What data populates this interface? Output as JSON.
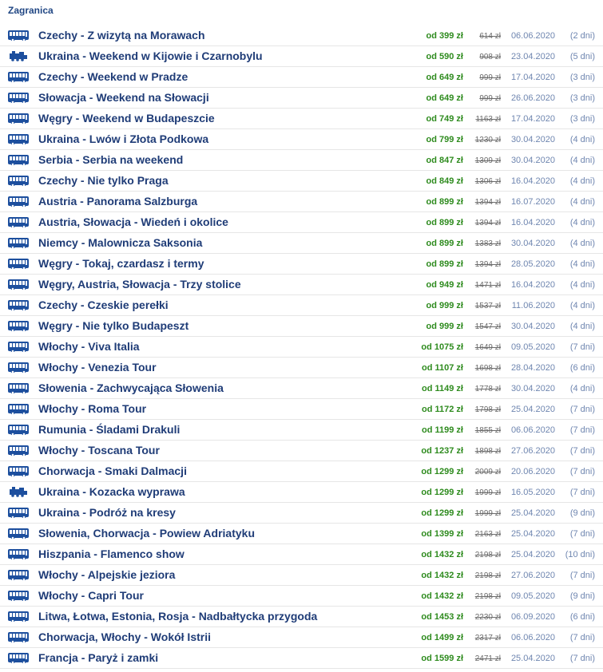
{
  "section_title": "Zagranica",
  "items": [
    {
      "transport": "bus",
      "title": "Czechy - Z wizytą na Morawach",
      "price": "od 399 zł",
      "old": "614 zł",
      "date": "06.06.2020",
      "duration": "(2 dni)"
    },
    {
      "transport": "train",
      "title": "Ukraina - Weekend w Kijowie i Czarnobylu",
      "price": "od 590 zł",
      "old": "908 zł",
      "date": "23.04.2020",
      "duration": "(5 dni)"
    },
    {
      "transport": "bus",
      "title": "Czechy - Weekend w Pradze",
      "price": "od 649 zł",
      "old": "999 zł",
      "date": "17.04.2020",
      "duration": "(3 dni)"
    },
    {
      "transport": "bus",
      "title": "Słowacja - Weekend na Słowacji",
      "price": "od 649 zł",
      "old": "999 zł",
      "date": "26.06.2020",
      "duration": "(3 dni)"
    },
    {
      "transport": "bus",
      "title": "Węgry - Weekend w Budapeszcie",
      "price": "od 749 zł",
      "old": "1163 zł",
      "date": "17.04.2020",
      "duration": "(3 dni)"
    },
    {
      "transport": "bus",
      "title": "Ukraina - Lwów i Złota Podkowa",
      "price": "od 799 zł",
      "old": "1230 zł",
      "date": "30.04.2020",
      "duration": "(4 dni)"
    },
    {
      "transport": "bus",
      "title": "Serbia - Serbia na weekend",
      "price": "od 847 zł",
      "old": "1309 zł",
      "date": "30.04.2020",
      "duration": "(4 dni)"
    },
    {
      "transport": "bus",
      "title": "Czechy - Nie tylko Praga",
      "price": "od 849 zł",
      "old": "1306 zł",
      "date": "16.04.2020",
      "duration": "(4 dni)"
    },
    {
      "transport": "bus",
      "title": "Austria - Panorama Salzburga",
      "price": "od 899 zł",
      "old": "1394 zł",
      "date": "16.07.2020",
      "duration": "(4 dni)"
    },
    {
      "transport": "bus",
      "title": "Austria, Słowacja - Wiedeń i okolice",
      "price": "od 899 zł",
      "old": "1394 zł",
      "date": "16.04.2020",
      "duration": "(4 dni)"
    },
    {
      "transport": "bus",
      "title": "Niemcy - Malownicza Saksonia",
      "price": "od 899 zł",
      "old": "1383 zł",
      "date": "30.04.2020",
      "duration": "(4 dni)"
    },
    {
      "transport": "bus",
      "title": "Węgry - Tokaj, czardasz i termy",
      "price": "od 899 zł",
      "old": "1394 zł",
      "date": "28.05.2020",
      "duration": "(4 dni)"
    },
    {
      "transport": "bus",
      "title": "Węgry, Austria, Słowacja - Trzy stolice",
      "price": "od 949 zł",
      "old": "1471 zł",
      "date": "16.04.2020",
      "duration": "(4 dni)"
    },
    {
      "transport": "bus",
      "title": "Czechy - Czeskie perełki",
      "price": "od 999 zł",
      "old": "1537 zł",
      "date": "11.06.2020",
      "duration": "(4 dni)"
    },
    {
      "transport": "bus",
      "title": "Węgry - Nie tylko Budapeszt",
      "price": "od 999 zł",
      "old": "1547 zł",
      "date": "30.04.2020",
      "duration": "(4 dni)"
    },
    {
      "transport": "bus",
      "title": "Włochy - Viva Italia",
      "price": "od 1075 zł",
      "old": "1649 zł",
      "date": "09.05.2020",
      "duration": "(7 dni)"
    },
    {
      "transport": "bus",
      "title": "Włochy - Venezia Tour",
      "price": "od 1107 zł",
      "old": "1698 zł",
      "date": "28.04.2020",
      "duration": "(6 dni)"
    },
    {
      "transport": "bus",
      "title": "Słowenia - Zachwycająca Słowenia",
      "price": "od 1149 zł",
      "old": "1778 zł",
      "date": "30.04.2020",
      "duration": "(4 dni)"
    },
    {
      "transport": "bus",
      "title": "Włochy - Roma Tour",
      "price": "od 1172 zł",
      "old": "1798 zł",
      "date": "25.04.2020",
      "duration": "(7 dni)"
    },
    {
      "transport": "bus",
      "title": "Rumunia - Śladami Drakuli",
      "price": "od 1199 zł",
      "old": "1855 zł",
      "date": "06.06.2020",
      "duration": "(7 dni)"
    },
    {
      "transport": "bus",
      "title": "Włochy - Toscana Tour",
      "price": "od 1237 zł",
      "old": "1898 zł",
      "date": "27.06.2020",
      "duration": "(7 dni)"
    },
    {
      "transport": "bus",
      "title": "Chorwacja - Smaki Dalmacji",
      "price": "od 1299 zł",
      "old": "2009 zł",
      "date": "20.06.2020",
      "duration": "(7 dni)"
    },
    {
      "transport": "train",
      "title": "Ukraina - Kozacka wyprawa",
      "price": "od 1299 zł",
      "old": "1999 zł",
      "date": "16.05.2020",
      "duration": "(7 dni)"
    },
    {
      "transport": "bus",
      "title": "Ukraina - Podróż na kresy",
      "price": "od 1299 zł",
      "old": "1999 zł",
      "date": "25.04.2020",
      "duration": "(9 dni)"
    },
    {
      "transport": "bus",
      "title": "Słowenia, Chorwacja - Powiew Adriatyku",
      "price": "od 1399 zł",
      "old": "2163 zł",
      "date": "25.04.2020",
      "duration": "(7 dni)"
    },
    {
      "transport": "bus",
      "title": "Hiszpania - Flamenco show",
      "price": "od 1432 zł",
      "old": "2198 zł",
      "date": "25.04.2020",
      "duration": "(10 dni)"
    },
    {
      "transport": "bus",
      "title": "Włochy - Alpejskie jeziora",
      "price": "od 1432 zł",
      "old": "2198 zł",
      "date": "27.06.2020",
      "duration": "(7 dni)"
    },
    {
      "transport": "bus",
      "title": "Włochy - Capri Tour",
      "price": "od 1432 zł",
      "old": "2198 zł",
      "date": "09.05.2020",
      "duration": "(9 dni)"
    },
    {
      "transport": "bus",
      "title": "Litwa, Łotwa, Estonia, Rosja - Nadbałtycka przygoda",
      "price": "od 1453 zł",
      "old": "2230 zł",
      "date": "06.09.2020",
      "duration": "(6 dni)"
    },
    {
      "transport": "bus",
      "title": "Chorwacja, Włochy - Wokół Istrii",
      "price": "od 1499 zł",
      "old": "2317 zł",
      "date": "06.06.2020",
      "duration": "(7 dni)"
    },
    {
      "transport": "bus",
      "title": "Francja - Paryż i zamki",
      "price": "od 1599 zł",
      "old": "2471 zł",
      "date": "25.04.2020",
      "duration": "(7 dni)"
    }
  ],
  "colors": {
    "title": "#1f3c77",
    "price": "#2e8b1e",
    "meta": "#6f86b0",
    "icon": "#1d4f9e"
  }
}
